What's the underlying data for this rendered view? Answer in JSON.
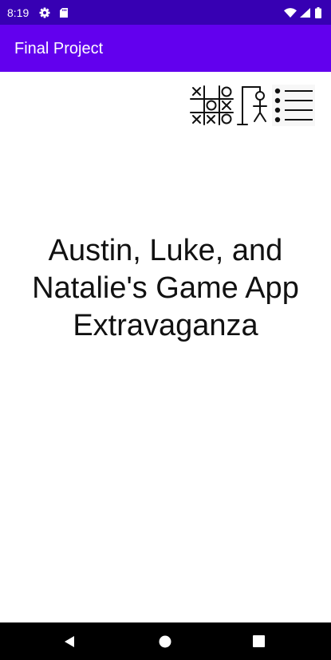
{
  "status_bar": {
    "time": "8:19",
    "icons": [
      "settings-icon",
      "sd-card-icon",
      "wifi-icon",
      "signal-icon",
      "battery-icon"
    ]
  },
  "app_bar": {
    "title": "Final Project",
    "color": "#6200ee",
    "status_color": "#3700b3"
  },
  "game_icons": [
    "tic-tac-toe-icon",
    "hangman-icon",
    "list-icon"
  ],
  "main": {
    "title_lines": [
      "Austin, Luke, and",
      "Natalie's Game App",
      "Extravaganza"
    ]
  },
  "nav_bar": {
    "icons": [
      "back-icon",
      "home-icon",
      "recents-icon"
    ]
  }
}
